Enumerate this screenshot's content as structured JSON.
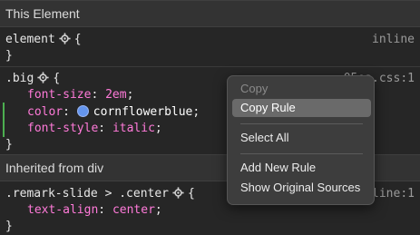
{
  "sections": {
    "this_element": "This Element",
    "inherited": "Inherited from div"
  },
  "rules": {
    "element": {
      "selector": "element",
      "open": "{",
      "close": "}",
      "source": "inline"
    },
    "big": {
      "selector": ".big",
      "open": "{",
      "close": "}",
      "source": "05ea.css:1",
      "declarations": [
        {
          "prop": "font-size",
          "value": "2em"
        },
        {
          "prop": "color",
          "value": "cornflowerblue",
          "swatch": "#6495ed"
        },
        {
          "prop": "font-style",
          "value": "italic"
        }
      ]
    },
    "remark": {
      "selector": ".remark-slide > .center",
      "open": "{",
      "close": "}",
      "source": "inline:1",
      "declarations": [
        {
          "prop": "text-align",
          "value": "center"
        }
      ]
    }
  },
  "context_menu": {
    "items": [
      "Copy",
      "Copy Rule",
      "Select All",
      "Add New Rule",
      "Show Original Sources"
    ]
  },
  "colors": {
    "background": "#262626",
    "header": "#333333",
    "property": "#ff7ad9",
    "modified_marker": "#4caf50",
    "menu_highlight": "#6a6a6a"
  }
}
